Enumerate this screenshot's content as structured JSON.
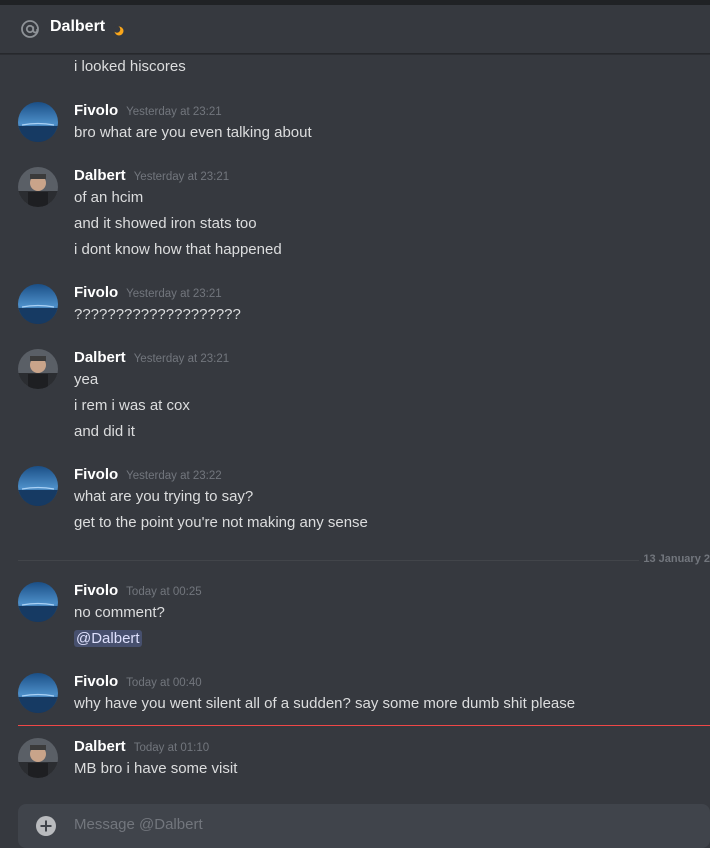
{
  "header": {
    "title": "Dalbert",
    "at_icon": "at-icon",
    "status_icon": "moon-icon"
  },
  "messages": {
    "m0": {
      "lines": [
        "i looked hiscores"
      ]
    },
    "m1": {
      "author": "Fivolo",
      "timestamp": "Yesterday at 23:21",
      "lines": [
        "bro what are you even talking about"
      ]
    },
    "m2": {
      "author": "Dalbert",
      "timestamp": "Yesterday at 23:21",
      "lines": [
        "of an hcim",
        "and it showed iron stats too",
        "i dont know how that happened"
      ]
    },
    "m3": {
      "author": "Fivolo",
      "timestamp": "Yesterday at 23:21",
      "lines": [
        "????????????????????"
      ]
    },
    "m4": {
      "author": "Dalbert",
      "timestamp": "Yesterday at 23:21",
      "lines": [
        "yea",
        "i rem i was at cox",
        "and did it"
      ]
    },
    "m5": {
      "author": "Fivolo",
      "timestamp": "Yesterday at 23:22",
      "lines": [
        "what are you trying to say?",
        "get to the point you're not making any sense"
      ]
    },
    "date_divider": "13 January 2",
    "m6": {
      "author": "Fivolo",
      "timestamp": "Today at 00:25",
      "lines": [
        "no comment?"
      ],
      "mention": "@Dalbert"
    },
    "m7": {
      "author": "Fivolo",
      "timestamp": "Today at 00:40",
      "lines": [
        "why have you went silent all of a sudden? say some more dumb shit please"
      ]
    },
    "m8": {
      "author": "Dalbert",
      "timestamp": "Today at 01:10",
      "lines": [
        "MB bro i have some visit"
      ]
    }
  },
  "composer": {
    "placeholder": "Message @Dalbert",
    "attach_icon": "plus-circle-icon"
  },
  "colors": {
    "background": "#36393f",
    "text": "#dcddde",
    "timestamp": "#72767d",
    "new_divider": "#f04747",
    "mention_bg": "#4b528a"
  }
}
